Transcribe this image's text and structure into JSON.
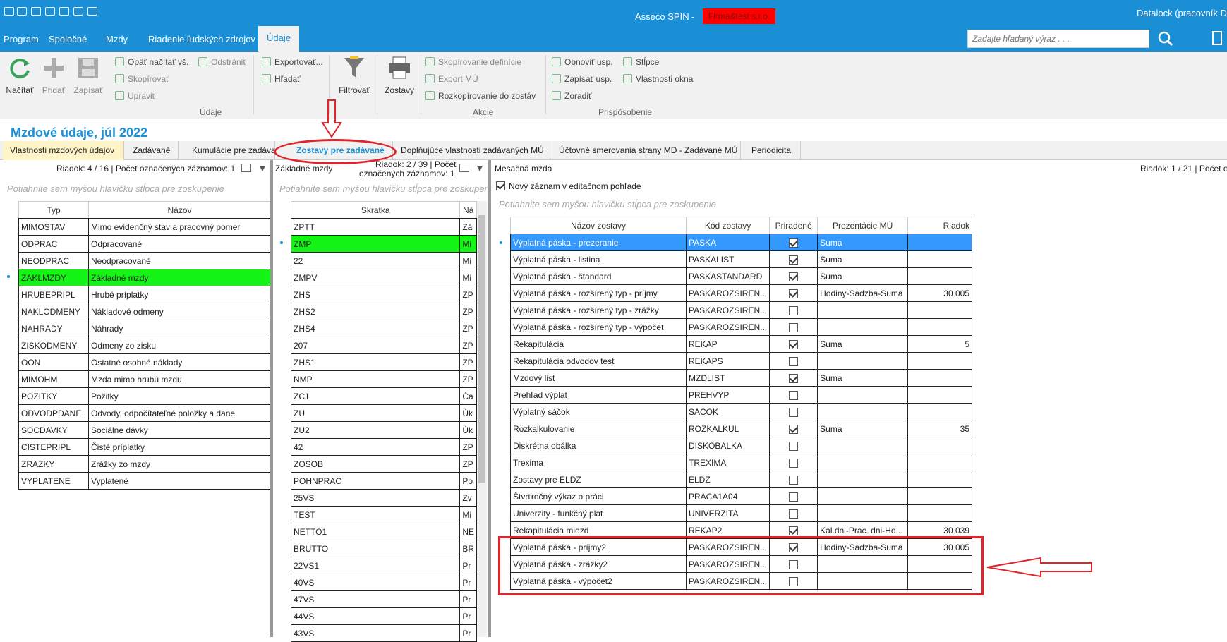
{
  "app": {
    "name": "Asseco SPIN",
    "separator": "-",
    "company": "Firma&test s.r.o.",
    "user": "Datalock (pracovník Dat"
  },
  "menu": [
    "Program",
    "Spoločné",
    "Mzdy",
    "Riadenie ľudských zdrojov",
    "Údaje"
  ],
  "search": {
    "placeholder": "Zadajte hľadaný výraz . . ."
  },
  "ribbon": {
    "big": {
      "load": "Načítať",
      "add": "Pridať",
      "save": "Zapísať",
      "filter": "Filtrovať",
      "reports": "Zostavy"
    },
    "udaje": {
      "reload": "Opäť načítať vš.",
      "remove": "Odstrániť",
      "copy": "Skopírovať",
      "edit": "Upraviť",
      "label": "Údaje"
    },
    "export": {
      "export": "Exportovať...",
      "find": "Hľadať"
    },
    "akcie": {
      "copy_def": "Skopírovanie definície",
      "export_mu": "Export MÚ",
      "copy_reports": "Rozkopírovanie do zostáv",
      "label": "Akcie"
    },
    "prisp": {
      "refresh": "Obnoviť usp.",
      "save": "Zapísať usp.",
      "sort": "Zoradiť",
      "columns": "Stĺpce",
      "window_props": "Vlastnosti okna",
      "label": "Prispôsobenie"
    }
  },
  "page_title": "Mzdové údaje, júl 2022",
  "tabs": [
    "Vlastnosti mzdových údajov",
    "Zadávané",
    "Kumulácie pre zadávané",
    "Zostavy pre zadávané",
    "Doplňujúce vlastnosti zadávaných MÚ",
    "Účtovné smerovania strany MD - Zadávané MÚ",
    "Periodicita"
  ],
  "group_hint": "Potiahnite sem myšou hlavičku stĺpca pre zoskupenie",
  "left": {
    "status": "Riadok: 4 / 16 | Počet označených záznamov: 1",
    "headers": [
      "Typ",
      "Názov"
    ],
    "rows": [
      [
        "MIMOSTAV",
        "Mimo evidenčný stav a pracovný pomer"
      ],
      [
        "ODPRAC",
        "Odpracované"
      ],
      [
        "NEODPRAC",
        "Neodpracované"
      ],
      [
        "ZAKLMZDY",
        "Základné mzdy"
      ],
      [
        "HRUBEPRIPL",
        "Hrubé príplatky"
      ],
      [
        "NAKLODMENY",
        "Nákladové odmeny"
      ],
      [
        "NAHRADY",
        "Náhrady"
      ],
      [
        "ZISKODMENY",
        "Odmeny zo zisku"
      ],
      [
        "OON",
        "Ostatné osobné náklady"
      ],
      [
        "MIMOHM",
        "Mzda mimo hrubú mzdu"
      ],
      [
        "POZITKY",
        "Požitky"
      ],
      [
        "ODVODPDANE",
        "Odvody, odpočítateľné položky a dane"
      ],
      [
        "SOCDAVKY",
        "Sociálne dávky"
      ],
      [
        "CISTEPRIPL",
        "Čisté príplatky"
      ],
      [
        "ZRAZKY",
        "Zrážky zo mzdy"
      ],
      [
        "VYPLATENE",
        "Vyplatené"
      ]
    ]
  },
  "middle": {
    "title": "Základné mzdy",
    "status_1": "Riadok: 2 / 39 | Počet",
    "status_2": "označených záznamov: 1",
    "headers": [
      "Skratka",
      "Ná"
    ],
    "rows": [
      [
        "ZPTT",
        "Zá"
      ],
      [
        "ZMP",
        "Mi"
      ],
      [
        "22",
        "Mi"
      ],
      [
        "ZMPV",
        "Mi"
      ],
      [
        "ZHS",
        "ZP"
      ],
      [
        "ZHS2",
        "ZP"
      ],
      [
        "ZHS4",
        "ZP"
      ],
      [
        "207",
        "ZP"
      ],
      [
        "ZHS1",
        "ZP"
      ],
      [
        "NMP",
        "ZP"
      ],
      [
        "ZC1",
        "Ča"
      ],
      [
        "ZU",
        "Úk"
      ],
      [
        "ZU2",
        "Úk"
      ],
      [
        "42",
        "ZP"
      ],
      [
        "ZOSOB",
        "ZP"
      ],
      [
        "POHNPRAC",
        "Po"
      ],
      [
        "25VS",
        "Zv"
      ],
      [
        "TEST",
        "Mi"
      ],
      [
        "NETTO1",
        "NE"
      ],
      [
        "BRUTTO",
        "BR"
      ],
      [
        "22VS1",
        "Pr"
      ],
      [
        "40VS",
        "Pr"
      ],
      [
        "47VS",
        "Pr"
      ],
      [
        "44VS",
        "Pr"
      ],
      [
        "43VS",
        "Pr"
      ]
    ]
  },
  "right": {
    "title": "Mesačná mzda",
    "status": "Riadok: 1 / 21 | Počet o",
    "new_record": "Nový záznam v editačnom pohľade",
    "headers": [
      "Názov zostavy",
      "Kód zostavy",
      "Priradené",
      "Prezentácie MÚ",
      "Riadok"
    ],
    "rows": [
      [
        "Výplatná páska - prezeranie",
        "PASKA",
        true,
        "Suma",
        ""
      ],
      [
        "Výplatná páska - listina",
        "PASKALIST",
        true,
        "Suma",
        ""
      ],
      [
        "Výplatná páska - štandard",
        "PASKASTANDARD",
        true,
        "Suma",
        ""
      ],
      [
        "Výplatná páska - rozšírený typ - príjmy",
        "PASKAROZSIREN...",
        true,
        "Hodiny-Sadzba-Suma",
        "30 005"
      ],
      [
        "Výplatná páska - rozšírený typ - zrážky",
        "PASKAROZSIREN...",
        false,
        "",
        ""
      ],
      [
        "Výplatná páska - rozšírený typ - výpočet",
        "PASKAROZSIREN...",
        false,
        "",
        ""
      ],
      [
        "Rekapitulácia",
        "REKAP",
        true,
        "Suma",
        "5"
      ],
      [
        "Rekapitulácia odvodov test",
        "REKAPS",
        false,
        "",
        ""
      ],
      [
        "Mzdový list",
        "MZDLIST",
        true,
        "Suma",
        ""
      ],
      [
        "Prehľad výplat",
        "PREHVYP",
        false,
        "",
        ""
      ],
      [
        "Výplatný sáčok",
        "SACOK",
        false,
        "",
        ""
      ],
      [
        "Rozkalkulovanie",
        "ROZKALKUL",
        true,
        "Suma",
        "35"
      ],
      [
        "Diskrétna obálka",
        "DISKOBALKA",
        false,
        "",
        ""
      ],
      [
        "Trexima",
        "TREXIMA",
        false,
        "",
        ""
      ],
      [
        "Zostavy pre ELDZ",
        "ELDZ",
        false,
        "",
        ""
      ],
      [
        "Štvrťročný výkaz o práci",
        "PRACA1A04",
        false,
        "",
        ""
      ],
      [
        "Univerzity - funkčný plat",
        "UNIVERZITA",
        false,
        "",
        ""
      ],
      [
        "Rekapitulácia miezd",
        "REKAP2",
        true,
        "Kal.dni-Prac. dni-Ho...",
        "30 039"
      ],
      [
        "Výplatná páska - príjmy2",
        "PASKAROZSIREN...",
        true,
        "Hodiny-Sadzba-Suma",
        "30 005"
      ],
      [
        "Výplatná páska - zrážky2",
        "PASKAROZSIREN...",
        false,
        "",
        ""
      ],
      [
        "Výplatná páska - výpočet2",
        "PASKAROZSIREN...",
        false,
        "",
        ""
      ]
    ]
  },
  "colors": {
    "accent": "#1b8fd6",
    "highlight_green": "#15f515",
    "selected_blue": "#3399ff",
    "annotation_red": "#e0242a",
    "company_bg": "#ff0000"
  }
}
